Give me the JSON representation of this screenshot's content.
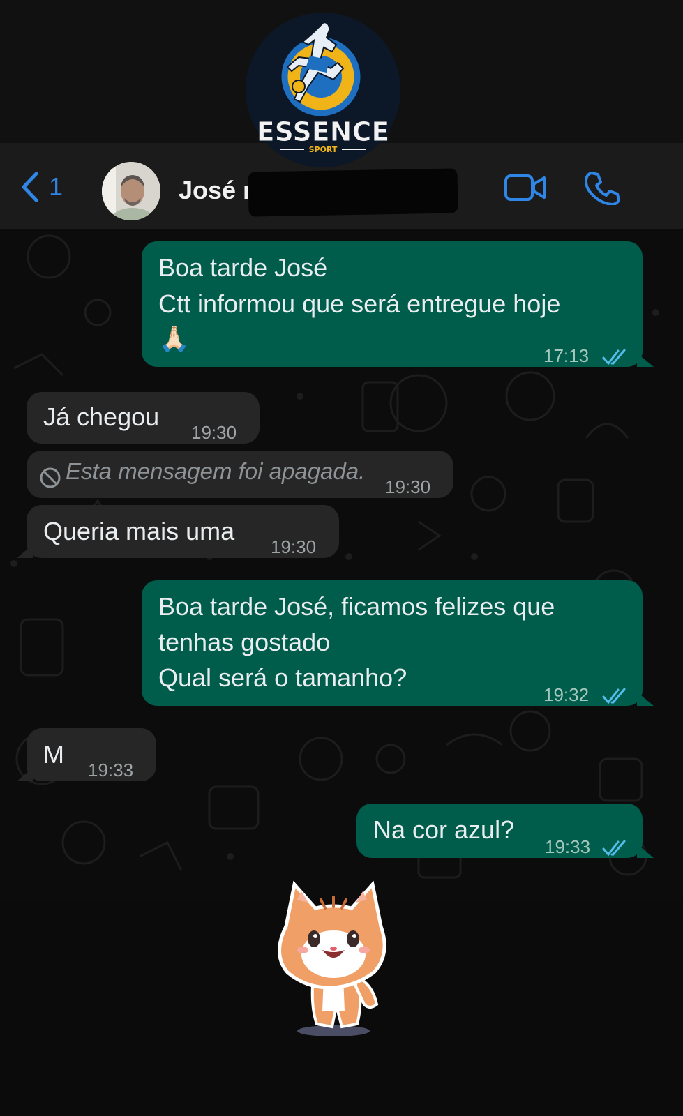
{
  "logo": {
    "text": "ESSENCE",
    "sub": "SPORT"
  },
  "header": {
    "back_count": "1",
    "contact_name": "José r",
    "colors": {
      "accent": "#2f86e6",
      "header_bg": "#1b1b1b"
    }
  },
  "messages": [
    {
      "direction": "out",
      "lines": [
        "Boa tarde José",
        "Ctt informou que será entregue hoje",
        "🙏🏻"
      ],
      "time": "17:13",
      "status": "read"
    },
    {
      "direction": "in",
      "text": "Já chegou",
      "time": "19:30"
    },
    {
      "direction": "in",
      "deleted": true,
      "text": "Esta mensagem foi apagada.",
      "time": "19:30"
    },
    {
      "direction": "in",
      "text": "Queria mais uma",
      "time": "19:30"
    },
    {
      "direction": "out",
      "lines": [
        "Boa tarde José, ficamos felizes que",
        "tenhas gostado",
        "Qual será o tamanho?"
      ],
      "time": "19:32",
      "status": "read"
    },
    {
      "direction": "in",
      "text": "M",
      "time": "19:33"
    },
    {
      "direction": "out",
      "text": "Na cor azul?",
      "time": "19:33",
      "status": "read"
    }
  ],
  "colors": {
    "outgoing_bubble": "#005c4b",
    "incoming_bubble": "#262626",
    "read_ticks": "#53bdeb"
  },
  "icons": {
    "back": "chevron-left-icon",
    "video": "video-call-icon",
    "phone": "phone-icon",
    "read": "double-check-icon",
    "deleted": "blocked-icon"
  },
  "sticker": "waving-cat-sticker"
}
